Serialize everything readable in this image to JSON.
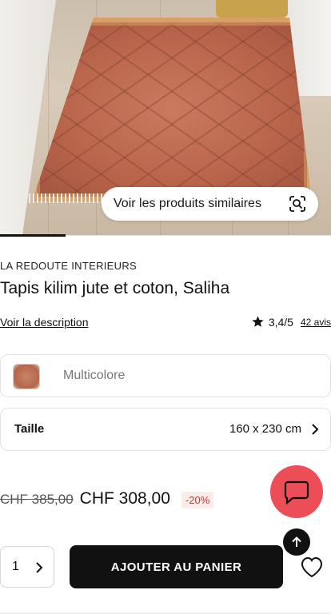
{
  "hero": {
    "similar_button_label": "Voir les produits similaires",
    "icons": {
      "similar": "image-search-icon"
    }
  },
  "product": {
    "brand": "LA REDOUTE INTERIEURS",
    "title": "Tapis kilim jute et coton, Saliha",
    "description_link": "Voir la description",
    "rating": "3,4/5",
    "reviews": "42 avis"
  },
  "color": {
    "name": "Multicolore"
  },
  "size": {
    "label": "Taille",
    "value": "160 x 230 cm"
  },
  "price": {
    "old": "CHF 385,00",
    "current": "CHF 308,00",
    "discount": "-20%"
  },
  "cart": {
    "quantity": "1",
    "add_label": "AJOUTER AU PANIER"
  },
  "colors": {
    "accent_chat": "#ec4d56",
    "discount": "#c0392b",
    "primary_button": "#111111"
  }
}
